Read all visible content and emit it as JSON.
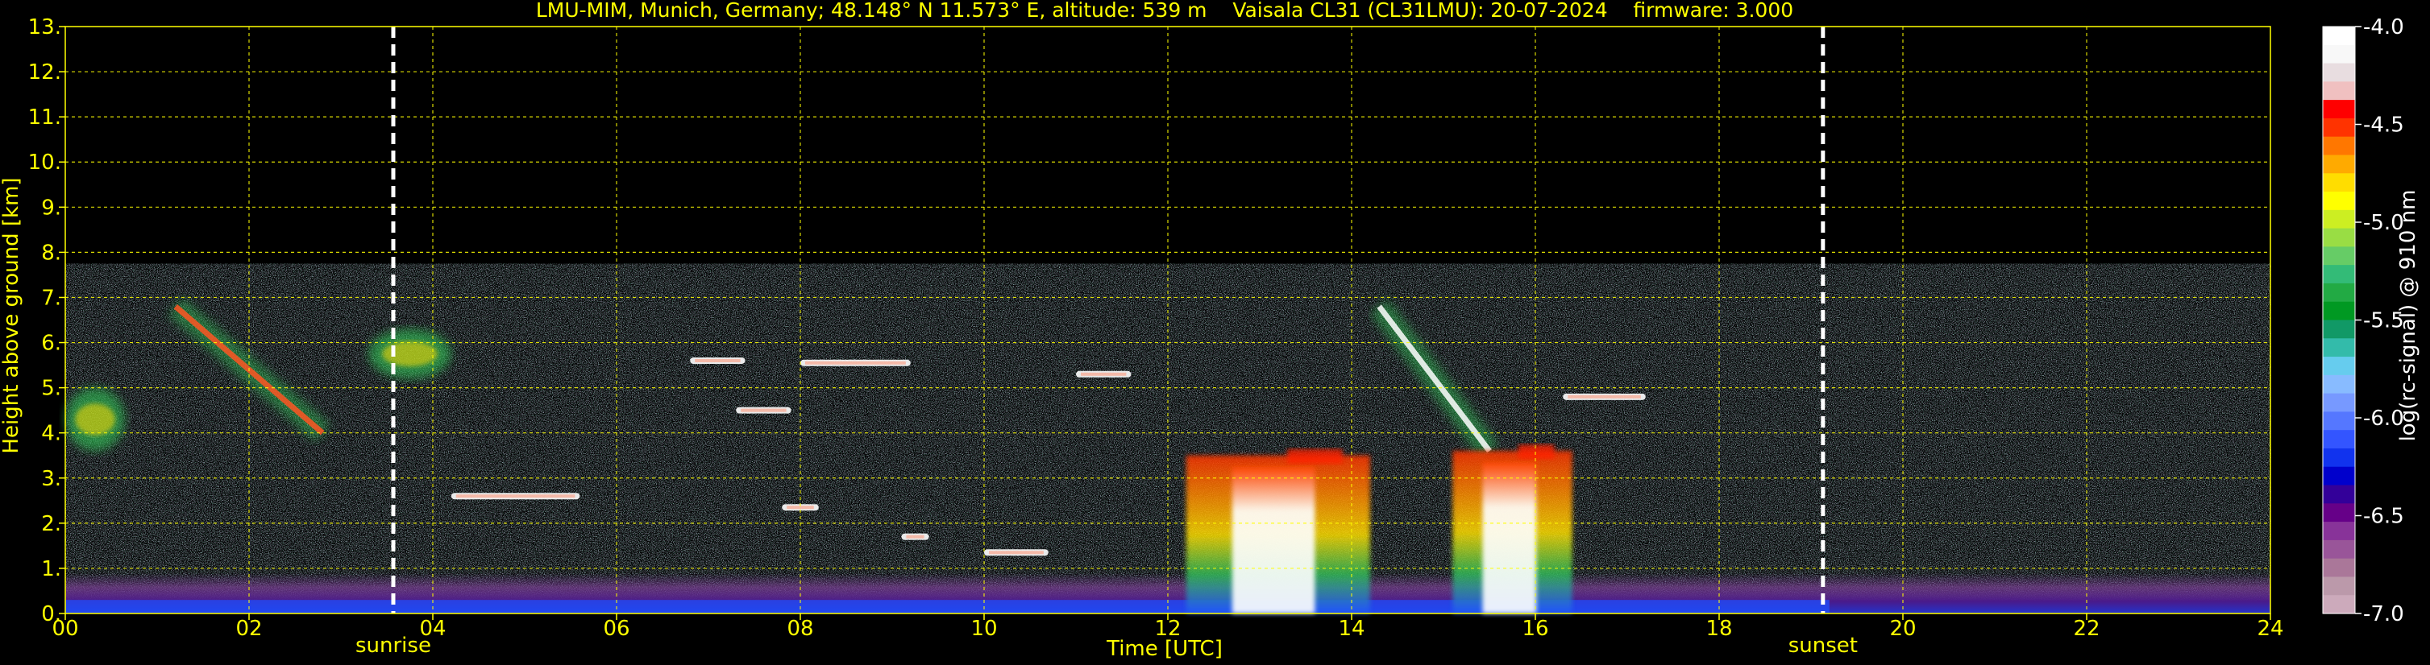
{
  "chart_data": {
    "type": "heatmap",
    "title": "LMU-MIM, Munich, Germany; 48.148° N 11.573° E, altitude: 539 m    Vaisala CL31 (CL31LMU): 20-07-2024    firmware: 3.000",
    "xlabel": "Time [UTC]",
    "ylabel": "Height above ground [km]",
    "xlim": [
      0,
      24
    ],
    "ylim": [
      0,
      13
    ],
    "x_ticks": [
      "00",
      "02",
      "04",
      "06",
      "08",
      "10",
      "12",
      "14",
      "16",
      "18",
      "20",
      "22",
      "24"
    ],
    "y_ticks": [
      "0.",
      "1.",
      "2.",
      "3.",
      "4.",
      "5.",
      "6.",
      "7.",
      "8.",
      "9.",
      "10.",
      "11.",
      "12.",
      "13."
    ],
    "grid": true,
    "markers": [
      {
        "label": "sunrise",
        "time_utc": 3.57
      },
      {
        "label": "sunset",
        "time_utc": 19.13
      }
    ],
    "colorbar": {
      "label": "log(rc-signal) @ 910 nm",
      "range": [
        -7.0,
        -4.0
      ],
      "ticks": [
        "-4.0",
        "-4.5",
        "-5.0",
        "-5.5",
        "-6.0",
        "-6.5",
        "-7.0"
      ],
      "colors": [
        "#ffffff",
        "#f8f8f8",
        "#e8dde0",
        "#f0c0c0",
        "#ff0000",
        "#ff3300",
        "#ff7700",
        "#ffaa00",
        "#ffdd00",
        "#ffff00",
        "#ccee22",
        "#99dd44",
        "#66cc66",
        "#33bb77",
        "#22aa44",
        "#009922",
        "#119966",
        "#33bbaa",
        "#66ccee",
        "#88bbff",
        "#7799ff",
        "#5577ff",
        "#3355ff",
        "#1133ee",
        "#0000cc",
        "#330099",
        "#660088",
        "#883399",
        "#995599",
        "#aa7799",
        "#bb99aa",
        "#ccaabb"
      ]
    },
    "noise_top_km": 7.75,
    "surface_layer_top_km": 0.9,
    "features": [
      {
        "kind": "aerosol",
        "t0": 0.0,
        "t1": 0.65,
        "h0": 3.6,
        "h1": 5.0,
        "intensity": "medium"
      },
      {
        "kind": "aerosol_band",
        "t0": 1.2,
        "t1": 2.8,
        "h0": 6.8,
        "h1": 4.0,
        "intensity": "high"
      },
      {
        "kind": "aerosol",
        "t0": 3.3,
        "t1": 4.2,
        "h0": 5.2,
        "h1": 6.3,
        "intensity": "high"
      },
      {
        "kind": "thin_layer",
        "t0": 4.2,
        "t1": 5.6,
        "h": 2.6
      },
      {
        "kind": "thin_layer",
        "t0": 6.8,
        "t1": 7.4,
        "h": 5.6
      },
      {
        "kind": "thin_layer",
        "t0": 7.3,
        "t1": 7.9,
        "h": 4.5
      },
      {
        "kind": "thin_layer",
        "t0": 8.0,
        "t1": 9.2,
        "h": 5.55
      },
      {
        "kind": "thin_layer",
        "t0": 7.8,
        "t1": 8.2,
        "h": 2.35
      },
      {
        "kind": "thin_layer",
        "t0": 9.1,
        "t1": 9.4,
        "h": 1.7
      },
      {
        "kind": "thin_layer",
        "t0": 10.0,
        "t1": 10.7,
        "h": 1.35
      },
      {
        "kind": "thin_layer",
        "t0": 11.0,
        "t1": 11.6,
        "h": 5.3
      },
      {
        "kind": "cloud",
        "t0": 12.2,
        "t1": 14.2,
        "h0": 0.0,
        "h1": 3.5,
        "intensity": "very_high"
      },
      {
        "kind": "cloud_slant",
        "t0": 14.3,
        "t1": 15.5,
        "h0": 6.8,
        "h1": 3.6
      },
      {
        "kind": "cloud",
        "t0": 15.1,
        "t1": 16.4,
        "h0": 0.0,
        "h1": 3.6,
        "intensity": "very_high"
      },
      {
        "kind": "thin_layer",
        "t0": 16.3,
        "t1": 17.2,
        "h": 4.8
      }
    ]
  }
}
